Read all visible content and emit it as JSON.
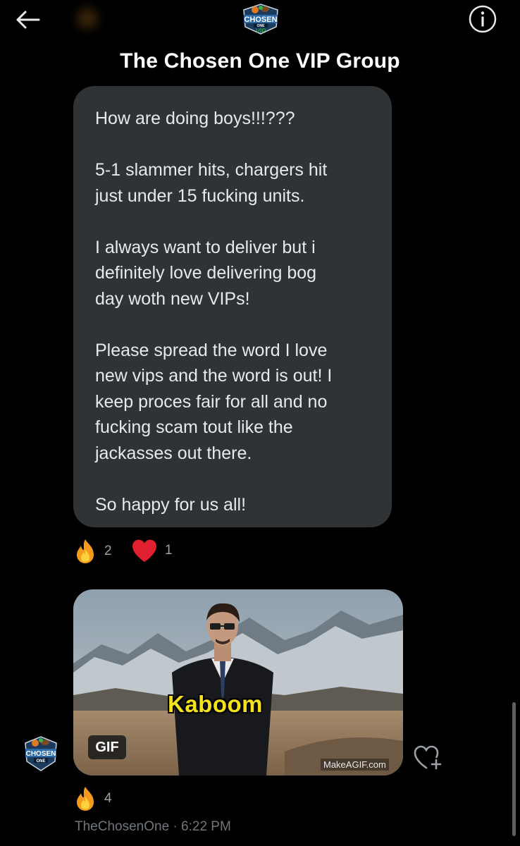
{
  "header": {
    "title": "The Chosen One VIP Group",
    "logo": {
      "line1": "CHOSEN",
      "line2": "ONE",
      "line3": "VIP"
    }
  },
  "message1": {
    "paragraphs": [
      "How are doing boys!!!???",
      "5-1 slammer hits, chargers hit\njust under 15 fucking units.",
      "I always want to deliver but i\ndefinitely  love delivering bog\nday woth new VIPs!",
      "Please spread the word I love\nnew vips and the word is out! I\nkeep proces fair for all and no\nfucking scam tout like the\njackasses out there.",
      "So happy for us all!"
    ],
    "reactions": [
      {
        "icon": "fire-emoji",
        "count": "2"
      },
      {
        "icon": "heart-emoji",
        "count": "1"
      }
    ]
  },
  "message2": {
    "gif_caption": "Kaboom",
    "gif_badge": "GIF",
    "watermark": "MakeAGIF.com",
    "reactions": [
      {
        "icon": "fire-emoji",
        "count": "4"
      }
    ],
    "sender": "TheChosenOne",
    "time": "6:22 PM",
    "meta_line": "TheChosenOne · 6:22 PM",
    "avatar_text": {
      "line1": "CHOSEN",
      "line2": "ONE"
    }
  },
  "colors": {
    "background": "#000000",
    "bubble": "#2f3336",
    "text": "#e7e9ea",
    "muted": "#71767b",
    "caption": "#f5e11b",
    "heart": "#e0202e"
  }
}
